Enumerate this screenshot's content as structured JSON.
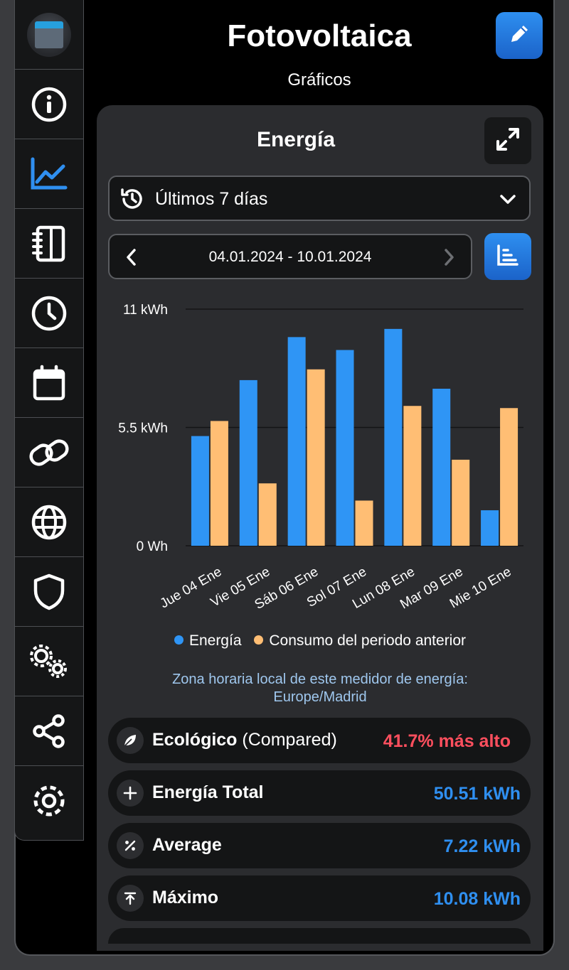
{
  "header": {
    "title": "Fotovoltaica",
    "subtitle": "Gráficos"
  },
  "sidebar": {
    "items": [
      {
        "icon": "device-thumbnail"
      },
      {
        "icon": "info-icon"
      },
      {
        "icon": "chart-line-icon",
        "active": true
      },
      {
        "icon": "notebook-icon"
      },
      {
        "icon": "clock-icon"
      },
      {
        "icon": "calendar-icon"
      },
      {
        "icon": "link-icon"
      },
      {
        "icon": "globe-icon"
      },
      {
        "icon": "shield-icon"
      },
      {
        "icon": "gears-icon"
      },
      {
        "icon": "share-icon"
      },
      {
        "icon": "settings-icon"
      }
    ]
  },
  "card": {
    "title": "Energía",
    "range_select": "Últimos 7 días",
    "date_range": "04.01.2024 - 10.01.2024",
    "legend": [
      "Energía",
      "Consumo del periodo anterior"
    ],
    "timezone_label": "Zona horaria local de este medidor de energía:",
    "timezone_value": "Europe/Madrid"
  },
  "stats": [
    {
      "icon": "leaf-icon",
      "name": "Ecológico",
      "extra": "(Compared)",
      "value": "41.7% más alto"
    },
    {
      "icon": "plus-icon",
      "name": "Energía Total",
      "extra": "",
      "value": "50.51 kWh"
    },
    {
      "icon": "percent-icon",
      "name": "Average",
      "extra": "",
      "value": "7.22 kWh"
    },
    {
      "icon": "max-icon",
      "name": "Máximo",
      "extra": "",
      "value": "10.08 kWh"
    }
  ],
  "colors": {
    "accent": "#2f8ff0",
    "series_energy": "#2f95f5",
    "series_previous": "#ffbe74",
    "negative": "#ff4f5e"
  },
  "chart_data": {
    "type": "bar",
    "categories": [
      "Jue 04 Ene",
      "Vie 05 Ene",
      "Sáb 06 Ene",
      "Sol 07 Ene",
      "Lun 08 Ene",
      "Mar 09 Ene",
      "Mie 10 Ene"
    ],
    "series": [
      {
        "name": "Energía",
        "values": [
          5.1,
          7.7,
          9.7,
          9.1,
          10.08,
          7.3,
          1.65
        ]
      },
      {
        "name": "Consumo del periodo anterior",
        "values": [
          5.8,
          2.9,
          8.2,
          2.1,
          6.5,
          4.0,
          6.4
        ]
      }
    ],
    "ylabel": "",
    "yticks": [
      "0 Wh",
      "5.5 kWh",
      "11 kWh"
    ],
    "ytick_values": [
      0,
      5.5,
      11
    ],
    "ylim": [
      0,
      11
    ],
    "grid": true,
    "legend_position": "bottom"
  }
}
